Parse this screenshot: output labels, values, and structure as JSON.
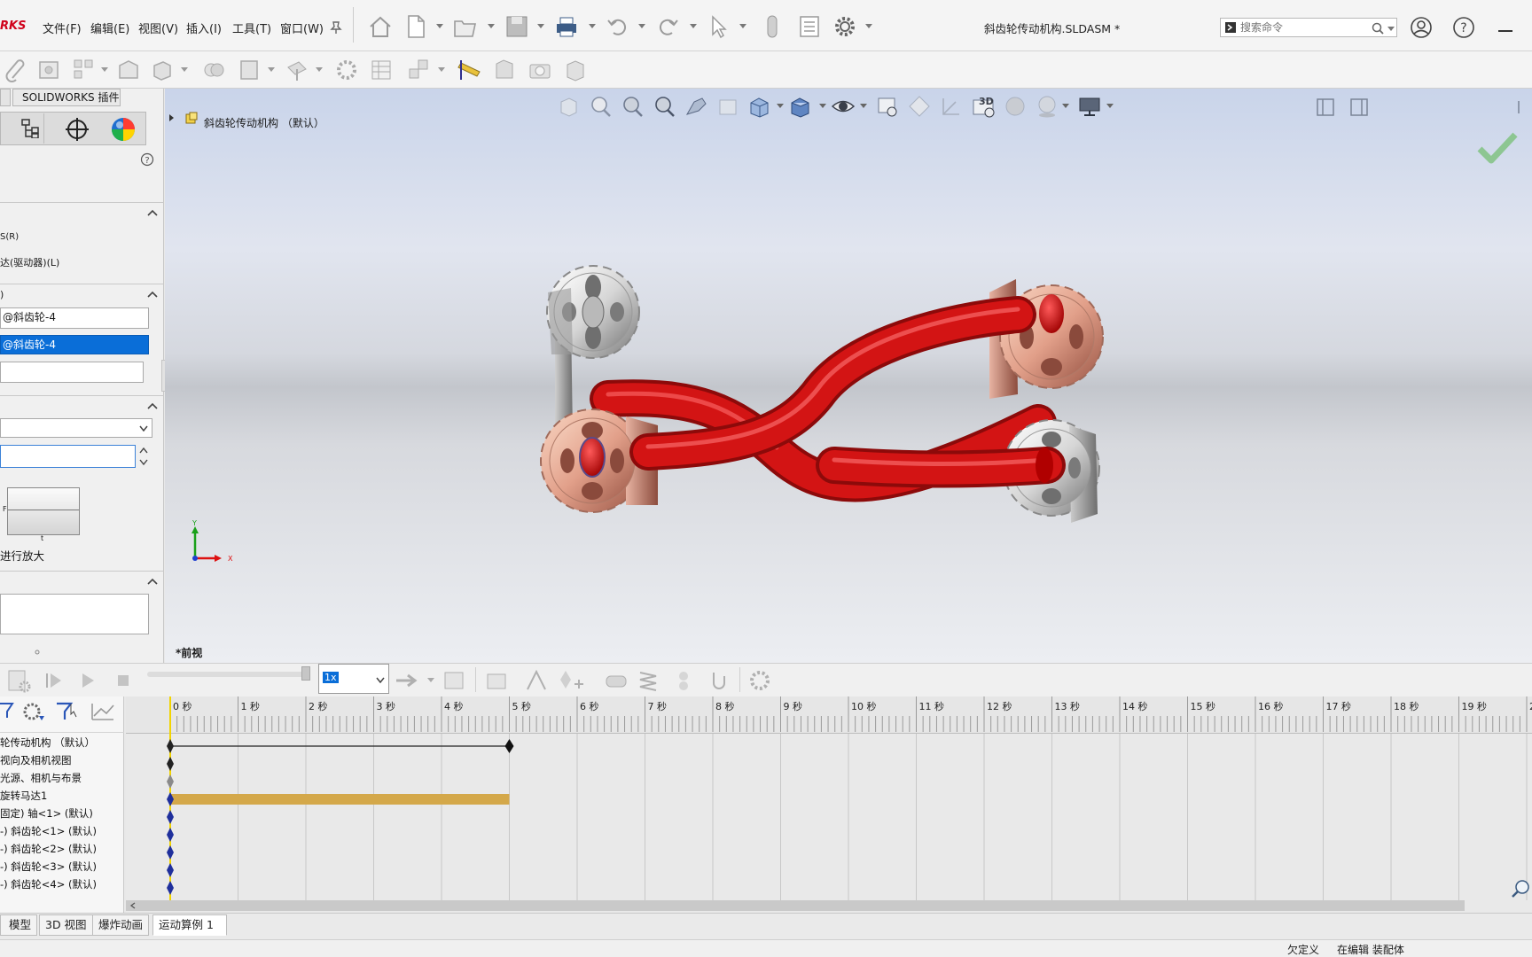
{
  "app": {
    "brand_fragment": "RKS",
    "document_title": "斜齿轮传动机构.SLDASM *"
  },
  "menu": {
    "items": [
      "文件(F)",
      "编辑(E)",
      "视图(V)",
      "插入(I)",
      "工具(T)",
      "窗口(W)"
    ]
  },
  "search": {
    "placeholder": "搜索命令"
  },
  "panel_tabs": {
    "addins_label": "SOLIDWORKS 插件"
  },
  "property_manager": {
    "option_r": "S(R)",
    "option_l": "达(驱动器)(L)",
    "section2_title": ")",
    "field_component": "@斜齿轮-4",
    "field_selected": "@斜齿轮-4",
    "graph_f_label": "F",
    "graph_t_label": "t",
    "zoom_label": "进行放大"
  },
  "viewport": {
    "tree_root_label": "斜齿轮传动机构 （默认）",
    "view_label": "*前视",
    "triad": {
      "y": "Y",
      "x": "X"
    },
    "heads_up_3d_label": "3D"
  },
  "motion_manager": {
    "speed_value": "1x",
    "timeline_seconds": [
      "0 秒",
      "1 秒",
      "2 秒",
      "3 秒",
      "4 秒",
      "5 秒",
      "6 秒",
      "7 秒",
      "8 秒",
      "9 秒",
      "10 秒",
      "11 秒",
      "12 秒",
      "13 秒",
      "14 秒",
      "15 秒",
      "16 秒",
      "17 秒",
      "18 秒",
      "19 秒",
      "2"
    ],
    "motor_duration_seconds": 5,
    "tree_items": [
      "轮传动机构 （默认）",
      "视向及相机视图",
      "光源、相机与布景",
      "旋转马达1",
      "固定) 轴<1> (默认)",
      "-) 斜齿轮<1> (默认)",
      "-) 斜齿轮<2> (默认)",
      "-) 斜齿轮<3> (默认)",
      "-) 斜齿轮<4> (默认)"
    ]
  },
  "bottom_tabs": [
    "模型",
    "3D 视图",
    "爆炸动画",
    "运动算例 1"
  ],
  "status_bar": {
    "under_defined": "欠定义",
    "editing": "在编辑 装配体"
  },
  "colors": {
    "brand_red": "#d0021b",
    "selection_blue": "#0a6ed8",
    "motor_bar": "#d4a84a",
    "belt_red": "#d31414",
    "confirm_green": "#7cc07c"
  }
}
